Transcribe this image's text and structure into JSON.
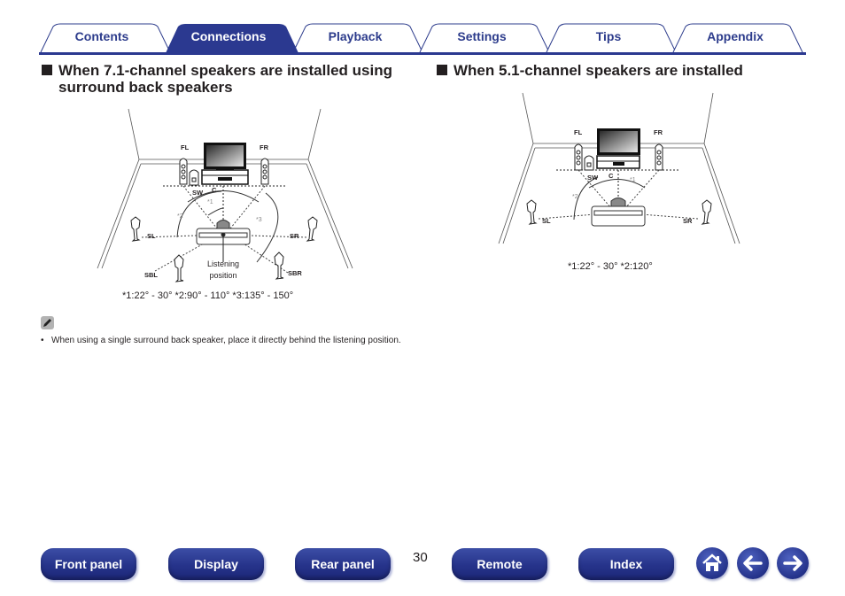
{
  "tabs": [
    {
      "label": "Contents",
      "active": false
    },
    {
      "label": "Connections",
      "active": true
    },
    {
      "label": "Playback",
      "active": false
    },
    {
      "label": "Settings",
      "active": false
    },
    {
      "label": "Tips",
      "active": false
    },
    {
      "label": "Appendix",
      "active": false
    }
  ],
  "colors": {
    "accent": "#2d3c8c",
    "tab_line": "#2b3990",
    "button": "#26338a"
  },
  "section_71": {
    "title_line1": "When 7.1-channel speakers are installed using",
    "title_line2": "surround back speakers",
    "labels": {
      "fl": "FL",
      "fr": "FR",
      "sw": "SW",
      "c": "C",
      "sl": "SL",
      "sr": "SR",
      "sbl": "SBL",
      "sbr": "SBR",
      "star1": "*1",
      "star2": "*2",
      "star3": "*3",
      "listening1": "Listening",
      "listening2": "position"
    },
    "caption": "*1:22° - 30°  *2:90° - 110°  *3:135° - 150°",
    "note_icon": "pencil-icon",
    "note_bullet": "•",
    "note_text": "When using a single surround back speaker, place it directly behind the listening position."
  },
  "section_51": {
    "title": "When 5.1-channel speakers are installed",
    "labels": {
      "fl": "FL",
      "fr": "FR",
      "sw": "SW",
      "c": "C",
      "sl": "SL",
      "sr": "SR",
      "star1": "*1",
      "star2": "*2"
    },
    "caption": "*1:22° - 30°  *2:120°"
  },
  "footer": {
    "buttons": [
      "Front panel",
      "Display",
      "Rear panel",
      "Remote",
      "Index"
    ],
    "page_number": "30",
    "icons": [
      "home-icon",
      "arrow-left-icon",
      "arrow-right-icon"
    ]
  }
}
